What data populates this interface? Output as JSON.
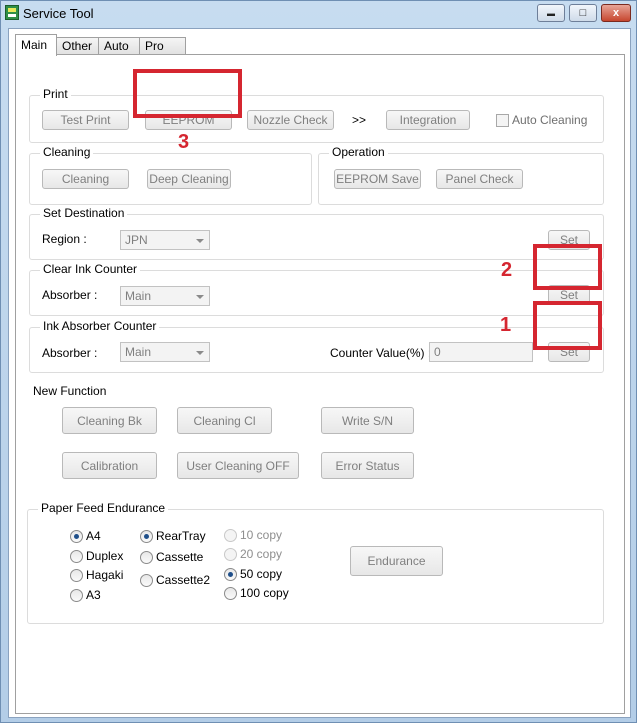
{
  "window": {
    "title": "Service Tool",
    "min": "▬",
    "max": "□",
    "close": "x"
  },
  "tabs": [
    "Main",
    "Other",
    "Auto",
    "Pro"
  ],
  "print": {
    "label": "Print",
    "test_print": "Test Print",
    "eeprom": "EEPROM",
    "nozzle_check": "Nozzle Check",
    "arrows": ">>",
    "integration": "Integration",
    "auto_cleaning": "Auto Cleaning"
  },
  "cleaning": {
    "label": "Cleaning",
    "cleaning": "Cleaning",
    "deep_cleaning": "Deep Cleaning"
  },
  "operation": {
    "label": "Operation",
    "eeprom_save": "EEPROM Save",
    "panel_check": "Panel Check"
  },
  "set_destination": {
    "label": "Set Destination",
    "region_label": "Region :",
    "region_value": "JPN",
    "set": "Set"
  },
  "clear_ink_counter": {
    "label": "Clear Ink Counter",
    "absorber_label": "Absorber :",
    "absorber_value": "Main",
    "set": "Set"
  },
  "ink_absorber_counter": {
    "label": "Ink Absorber Counter",
    "absorber_label": "Absorber :",
    "absorber_value": "Main",
    "counter_label": "Counter Value(%) :",
    "counter_value": "0",
    "set": "Set"
  },
  "new_function": {
    "label": "New Function",
    "cleaning_bk": "Cleaning Bk",
    "cleaning_cl": "Cleaning Cl",
    "write_sn": "Write S/N",
    "calibration": "Calibration",
    "user_cleaning_off": "User Cleaning OFF",
    "error_status": "Error Status"
  },
  "paper_feed": {
    "label": "Paper Feed Endurance",
    "sizes": [
      {
        "label": "A4",
        "checked": true
      },
      {
        "label": "Duplex",
        "checked": false
      },
      {
        "label": "Hagaki",
        "checked": false
      },
      {
        "label": "A3",
        "checked": false
      }
    ],
    "sources": [
      {
        "label": "RearTray",
        "checked": true
      },
      {
        "label": "Cassette",
        "checked": false
      },
      {
        "label": "Cassette2",
        "checked": false
      }
    ],
    "copies": [
      {
        "label": "10 copy",
        "checked": false,
        "disabled": true
      },
      {
        "label": "20 copy",
        "checked": false,
        "disabled": true
      },
      {
        "label": "50 copy",
        "checked": true,
        "disabled": false
      },
      {
        "label": "100 copy",
        "checked": false,
        "disabled": false
      }
    ],
    "endurance": "Endurance"
  },
  "annotations": {
    "marker_1": "1",
    "marker_2": "2",
    "marker_3": "3",
    "highlight_color": "#d52630"
  }
}
